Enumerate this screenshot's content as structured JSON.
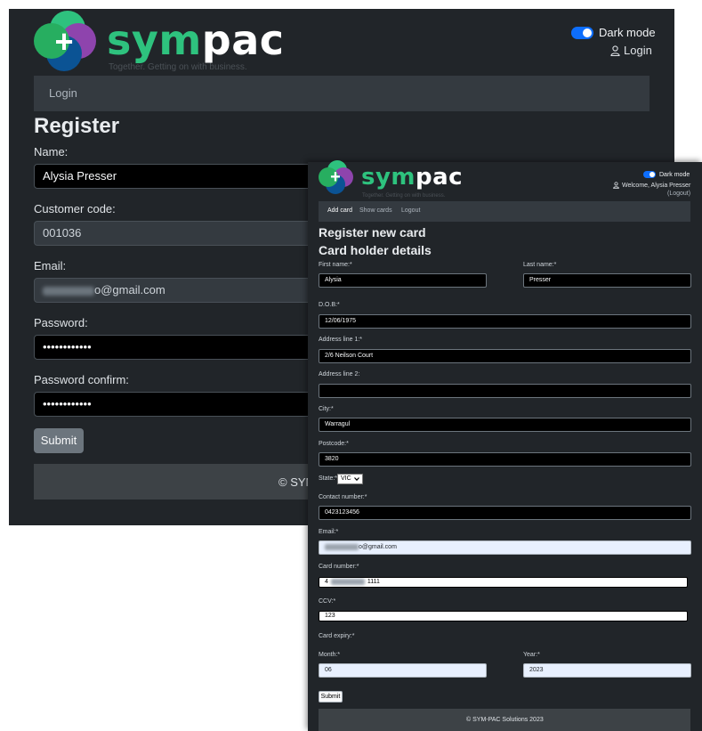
{
  "brand": {
    "name_part1": "sym",
    "name_part2": "pac",
    "tagline": "Together. Getting on with business."
  },
  "colors": {
    "background": "#212529",
    "navbar": "#343a40",
    "brand_green": "#2ec27e",
    "toggle_blue": "#0d6efd",
    "logo_purple": "#8e44ad",
    "logo_blue": "#0b5394"
  },
  "login_window": {
    "dark_mode_label": "Dark mode",
    "login_link": "Login",
    "nav": {
      "login": "Login"
    },
    "title": "Register",
    "fields": {
      "name": {
        "label": "Name:",
        "value": "Alysia Presser"
      },
      "customer_code": {
        "label": "Customer code:",
        "value": "001036"
      },
      "email": {
        "label": "Email:",
        "value": "o@gmail.com"
      },
      "password": {
        "label": "Password:",
        "value": "••••••••••••"
      },
      "password_confirm": {
        "label": "Password confirm:",
        "value": "••••••••••••"
      }
    },
    "submit": "Submit",
    "footer": "© SYM"
  },
  "card_window": {
    "dark_mode_label": "Dark mode",
    "welcome": "Welcome, Alysia Presser",
    "logout": "(Logout)",
    "nav": [
      "Add card",
      "Show cards",
      "Logout"
    ],
    "title": "Register new card",
    "subtitle": "Card holder details",
    "fields": {
      "first_name": {
        "label": "First name:*",
        "value": "Alysia"
      },
      "last_name": {
        "label": "Last name:*",
        "value": "Presser"
      },
      "dob": {
        "label": "D.O.B:*",
        "value": "12/06/1975"
      },
      "address1": {
        "label": "Address line 1:*",
        "value": "2/6 Neilson Court"
      },
      "address2": {
        "label": "Address line 2:",
        "value": ""
      },
      "city": {
        "label": "City:*",
        "value": "Warragul"
      },
      "postcode": {
        "label": "Postcode:*",
        "value": "3820"
      },
      "state": {
        "label": "State:*",
        "value": "VIC"
      },
      "contact": {
        "label": "Contact number:*",
        "value": "0423123456"
      },
      "email": {
        "label": "Email:*",
        "value": "o@gmail.com"
      },
      "card_number": {
        "label": "Card number:*",
        "value_start": "4",
        "value_end": "1111"
      },
      "ccv": {
        "label": "CCV:*",
        "value": "123"
      },
      "card_expiry": {
        "label": "Card expiry:*"
      },
      "month": {
        "label": "Month:*",
        "value": "06"
      },
      "year": {
        "label": "Year:*",
        "value": "2023"
      }
    },
    "submit": "Submit",
    "footer": "© SYM-PAC Solutions 2023"
  }
}
